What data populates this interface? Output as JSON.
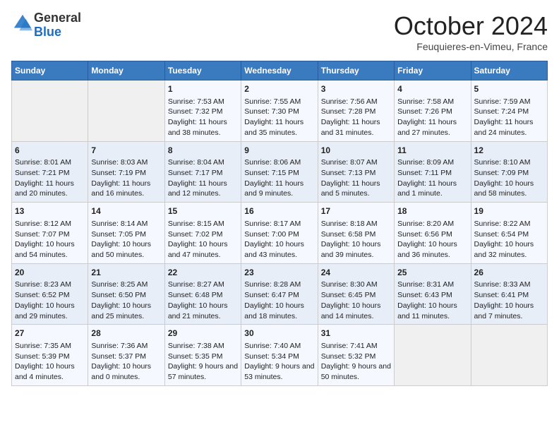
{
  "logo": {
    "general": "General",
    "blue": "Blue"
  },
  "header": {
    "month": "October 2024",
    "location": "Feuquieres-en-Vimeu, France"
  },
  "days_of_week": [
    "Sunday",
    "Monday",
    "Tuesday",
    "Wednesday",
    "Thursday",
    "Friday",
    "Saturday"
  ],
  "weeks": [
    [
      {
        "day": "",
        "empty": true
      },
      {
        "day": "",
        "empty": true
      },
      {
        "day": "1",
        "sunrise": "Sunrise: 7:53 AM",
        "sunset": "Sunset: 7:32 PM",
        "daylight": "Daylight: 11 hours and 38 minutes."
      },
      {
        "day": "2",
        "sunrise": "Sunrise: 7:55 AM",
        "sunset": "Sunset: 7:30 PM",
        "daylight": "Daylight: 11 hours and 35 minutes."
      },
      {
        "day": "3",
        "sunrise": "Sunrise: 7:56 AM",
        "sunset": "Sunset: 7:28 PM",
        "daylight": "Daylight: 11 hours and 31 minutes."
      },
      {
        "day": "4",
        "sunrise": "Sunrise: 7:58 AM",
        "sunset": "Sunset: 7:26 PM",
        "daylight": "Daylight: 11 hours and 27 minutes."
      },
      {
        "day": "5",
        "sunrise": "Sunrise: 7:59 AM",
        "sunset": "Sunset: 7:24 PM",
        "daylight": "Daylight: 11 hours and 24 minutes."
      }
    ],
    [
      {
        "day": "6",
        "sunrise": "Sunrise: 8:01 AM",
        "sunset": "Sunset: 7:21 PM",
        "daylight": "Daylight: 11 hours and 20 minutes."
      },
      {
        "day": "7",
        "sunrise": "Sunrise: 8:03 AM",
        "sunset": "Sunset: 7:19 PM",
        "daylight": "Daylight: 11 hours and 16 minutes."
      },
      {
        "day": "8",
        "sunrise": "Sunrise: 8:04 AM",
        "sunset": "Sunset: 7:17 PM",
        "daylight": "Daylight: 11 hours and 12 minutes."
      },
      {
        "day": "9",
        "sunrise": "Sunrise: 8:06 AM",
        "sunset": "Sunset: 7:15 PM",
        "daylight": "Daylight: 11 hours and 9 minutes."
      },
      {
        "day": "10",
        "sunrise": "Sunrise: 8:07 AM",
        "sunset": "Sunset: 7:13 PM",
        "daylight": "Daylight: 11 hours and 5 minutes."
      },
      {
        "day": "11",
        "sunrise": "Sunrise: 8:09 AM",
        "sunset": "Sunset: 7:11 PM",
        "daylight": "Daylight: 11 hours and 1 minute."
      },
      {
        "day": "12",
        "sunrise": "Sunrise: 8:10 AM",
        "sunset": "Sunset: 7:09 PM",
        "daylight": "Daylight: 10 hours and 58 minutes."
      }
    ],
    [
      {
        "day": "13",
        "sunrise": "Sunrise: 8:12 AM",
        "sunset": "Sunset: 7:07 PM",
        "daylight": "Daylight: 10 hours and 54 minutes."
      },
      {
        "day": "14",
        "sunrise": "Sunrise: 8:14 AM",
        "sunset": "Sunset: 7:05 PM",
        "daylight": "Daylight: 10 hours and 50 minutes."
      },
      {
        "day": "15",
        "sunrise": "Sunrise: 8:15 AM",
        "sunset": "Sunset: 7:02 PM",
        "daylight": "Daylight: 10 hours and 47 minutes."
      },
      {
        "day": "16",
        "sunrise": "Sunrise: 8:17 AM",
        "sunset": "Sunset: 7:00 PM",
        "daylight": "Daylight: 10 hours and 43 minutes."
      },
      {
        "day": "17",
        "sunrise": "Sunrise: 8:18 AM",
        "sunset": "Sunset: 6:58 PM",
        "daylight": "Daylight: 10 hours and 39 minutes."
      },
      {
        "day": "18",
        "sunrise": "Sunrise: 8:20 AM",
        "sunset": "Sunset: 6:56 PM",
        "daylight": "Daylight: 10 hours and 36 minutes."
      },
      {
        "day": "19",
        "sunrise": "Sunrise: 8:22 AM",
        "sunset": "Sunset: 6:54 PM",
        "daylight": "Daylight: 10 hours and 32 minutes."
      }
    ],
    [
      {
        "day": "20",
        "sunrise": "Sunrise: 8:23 AM",
        "sunset": "Sunset: 6:52 PM",
        "daylight": "Daylight: 10 hours and 29 minutes."
      },
      {
        "day": "21",
        "sunrise": "Sunrise: 8:25 AM",
        "sunset": "Sunset: 6:50 PM",
        "daylight": "Daylight: 10 hours and 25 minutes."
      },
      {
        "day": "22",
        "sunrise": "Sunrise: 8:27 AM",
        "sunset": "Sunset: 6:48 PM",
        "daylight": "Daylight: 10 hours and 21 minutes."
      },
      {
        "day": "23",
        "sunrise": "Sunrise: 8:28 AM",
        "sunset": "Sunset: 6:47 PM",
        "daylight": "Daylight: 10 hours and 18 minutes."
      },
      {
        "day": "24",
        "sunrise": "Sunrise: 8:30 AM",
        "sunset": "Sunset: 6:45 PM",
        "daylight": "Daylight: 10 hours and 14 minutes."
      },
      {
        "day": "25",
        "sunrise": "Sunrise: 8:31 AM",
        "sunset": "Sunset: 6:43 PM",
        "daylight": "Daylight: 10 hours and 11 minutes."
      },
      {
        "day": "26",
        "sunrise": "Sunrise: 8:33 AM",
        "sunset": "Sunset: 6:41 PM",
        "daylight": "Daylight: 10 hours and 7 minutes."
      }
    ],
    [
      {
        "day": "27",
        "sunrise": "Sunrise: 7:35 AM",
        "sunset": "Sunset: 5:39 PM",
        "daylight": "Daylight: 10 hours and 4 minutes."
      },
      {
        "day": "28",
        "sunrise": "Sunrise: 7:36 AM",
        "sunset": "Sunset: 5:37 PM",
        "daylight": "Daylight: 10 hours and 0 minutes."
      },
      {
        "day": "29",
        "sunrise": "Sunrise: 7:38 AM",
        "sunset": "Sunset: 5:35 PM",
        "daylight": "Daylight: 9 hours and 57 minutes."
      },
      {
        "day": "30",
        "sunrise": "Sunrise: 7:40 AM",
        "sunset": "Sunset: 5:34 PM",
        "daylight": "Daylight: 9 hours and 53 minutes."
      },
      {
        "day": "31",
        "sunrise": "Sunrise: 7:41 AM",
        "sunset": "Sunset: 5:32 PM",
        "daylight": "Daylight: 9 hours and 50 minutes."
      },
      {
        "day": "",
        "empty": true
      },
      {
        "day": "",
        "empty": true
      }
    ]
  ]
}
